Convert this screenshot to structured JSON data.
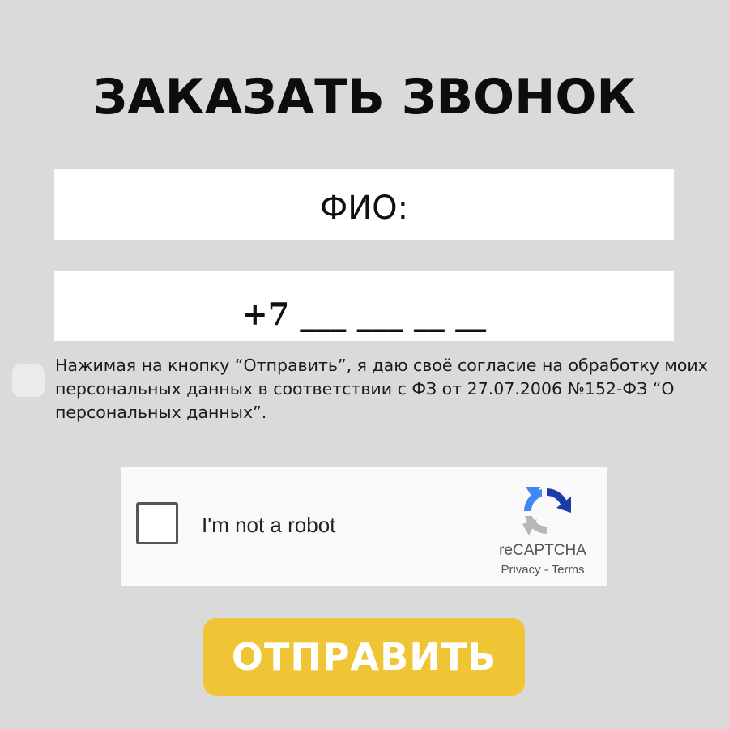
{
  "form": {
    "title": "ЗАКАЗАТЬ ЗВОНОК",
    "name_field": {
      "placeholder": "ФИО:",
      "value": ""
    },
    "phone_field": {
      "placeholder": "+7 ___ ___ __ __",
      "value": ""
    },
    "consent": {
      "checked": false,
      "text": "Нажимая на кнопку “Отправить”, я даю своё согласие на обработку моих персональных данных в соответствии с ФЗ от 27.07.2006 №152-ФЗ “О персональных данных”."
    },
    "recaptcha": {
      "label": "I'm not a robot",
      "brand": "reCAPTCHA",
      "privacy": "Privacy",
      "separator": "-",
      "terms": "Terms",
      "icon": "recaptcha-logo-icon",
      "colors": {
        "blue": "#1c3aa9",
        "light_blue": "#4285f4",
        "gray": "#b7b7b7"
      }
    },
    "submit_label": "ОТПРАВИТЬ"
  },
  "colors": {
    "background": "#dadada",
    "field_background": "#ffffff",
    "submit_background": "#efc535",
    "submit_text": "#ffffff",
    "title_text": "#0d0d0d"
  }
}
